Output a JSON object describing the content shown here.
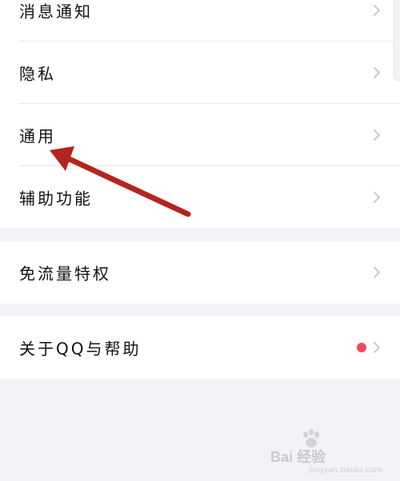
{
  "settings": {
    "items": [
      {
        "label": "消息通知"
      },
      {
        "label": "隐私"
      },
      {
        "label": "通用"
      },
      {
        "label": "辅助功能"
      },
      {
        "label": "免流量特权"
      },
      {
        "label": "关于QQ与帮助",
        "badge": "red-dot"
      }
    ]
  },
  "annotation": {
    "arrow_color": "#b3251f",
    "target": "通用"
  },
  "colors": {
    "background": "#f2f2f7",
    "row_background": "#ffffff",
    "divider": "#e6e6ea",
    "chevron": "#c4c4c8",
    "badge": "#f5475f"
  },
  "watermark": {
    "text": "Bai 经验",
    "sub": "jingyan.baidu.com"
  }
}
